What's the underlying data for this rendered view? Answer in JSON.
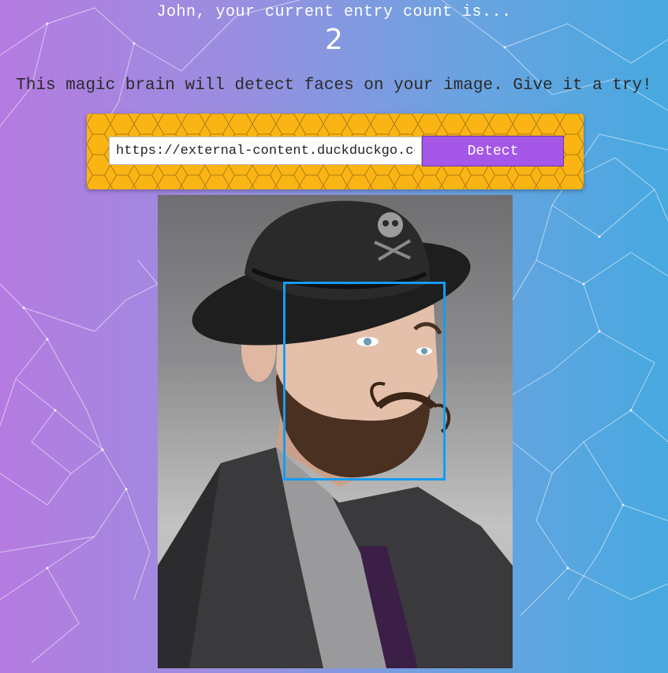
{
  "rank": {
    "message": "John, your current entry count is...",
    "count": "2"
  },
  "intro_text": "This magic brain will detect faces on your image. Give it a try!",
  "image_form": {
    "url_value": "https://external-content.duckduckgo.com/",
    "detect_label": "Detect"
  },
  "result": {
    "faces_detected": 1
  },
  "colors": {
    "button": "#a557e8",
    "panel": "#fab514",
    "face_box": "#149df2"
  },
  "icons": [
    "particle-network-background",
    "honeycomb-pattern"
  ]
}
